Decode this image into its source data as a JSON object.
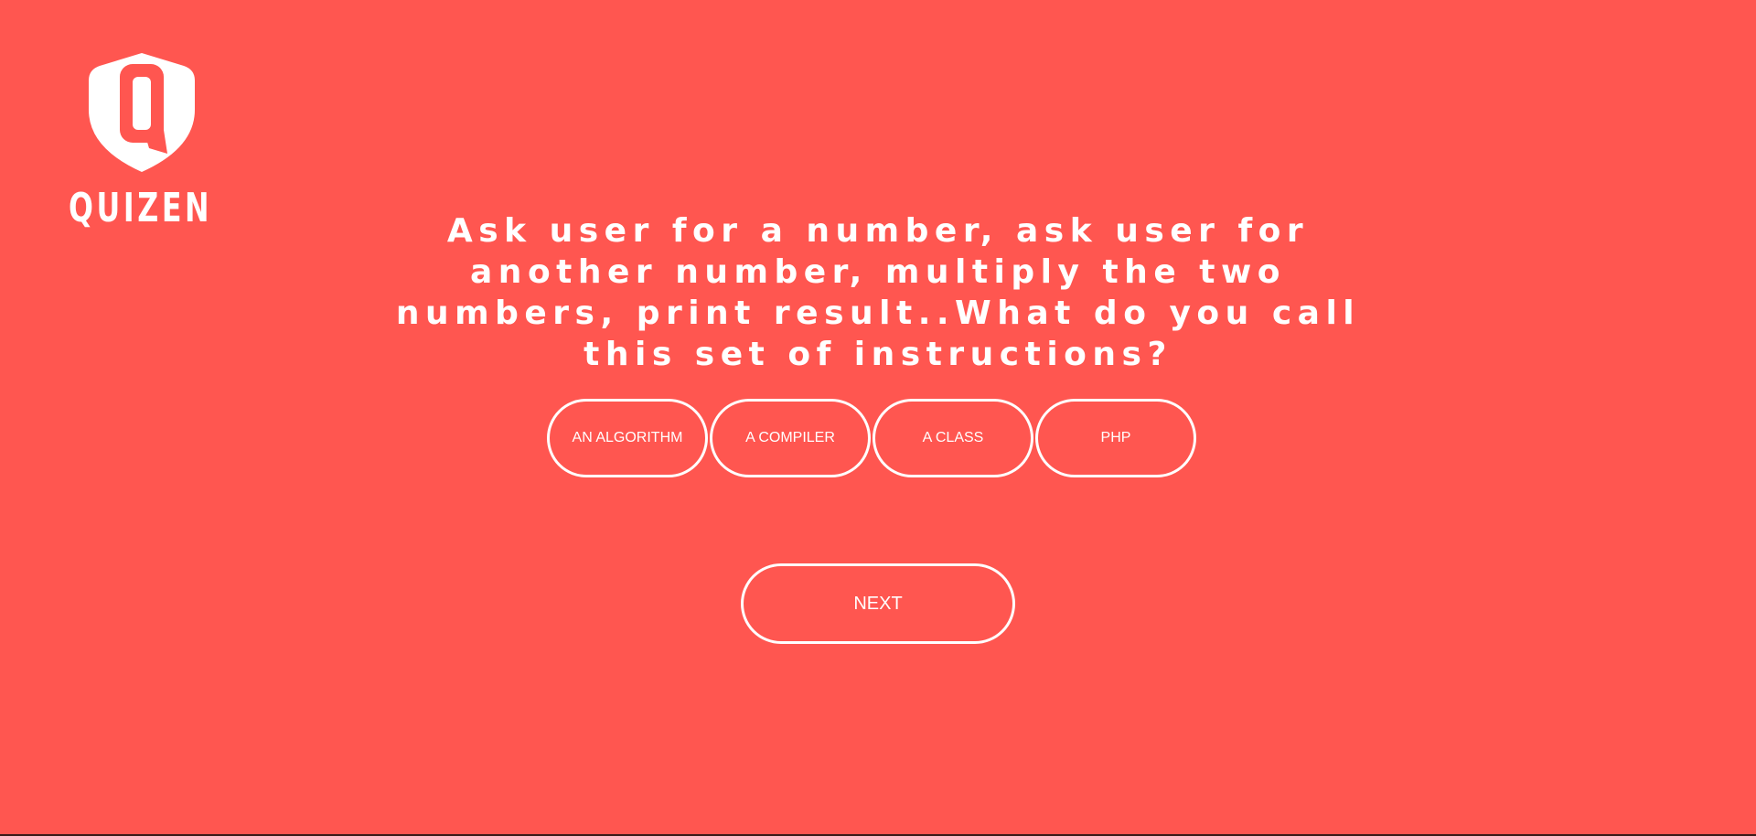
{
  "brand": {
    "logo_letter": "Q",
    "name": "QUIZEN",
    "logo_icon": "shield-q-icon"
  },
  "quiz": {
    "question": "Ask user for a number, ask user for another number, multiply the two numbers, print result..What do you call this set of instructions?",
    "options": [
      {
        "label": "AN ALGORITHM"
      },
      {
        "label": "A COMPILER"
      },
      {
        "label": "A CLASS"
      },
      {
        "label": "PHP"
      }
    ],
    "next_label": "NEXT"
  },
  "colors": {
    "background": "#ff5650",
    "foreground": "#ffffff"
  }
}
